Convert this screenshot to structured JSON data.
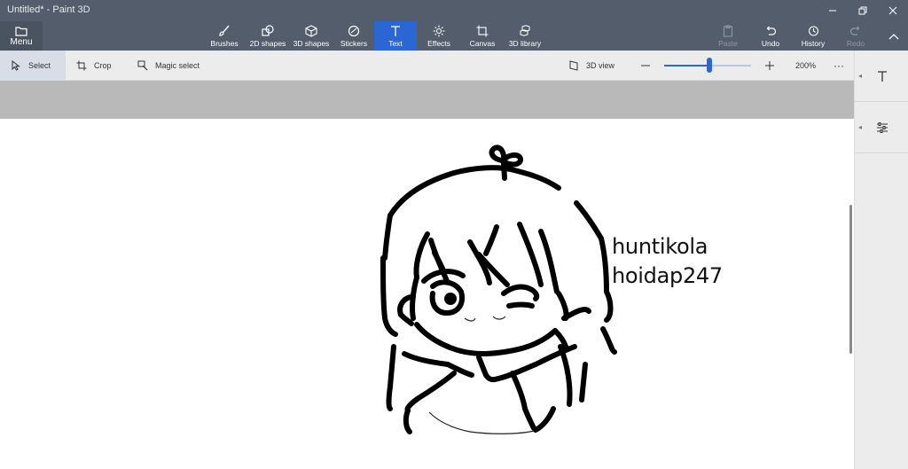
{
  "window": {
    "title": "Untitled* - Paint 3D"
  },
  "menu": {
    "label": "Menu"
  },
  "tools": [
    {
      "id": "brushes",
      "label": "Brushes",
      "icon": "brush-icon"
    },
    {
      "id": "2d-shapes",
      "label": "2D shapes",
      "icon": "2d-shapes-icon"
    },
    {
      "id": "3d-shapes",
      "label": "3D shapes",
      "icon": "cube-icon"
    },
    {
      "id": "stickers",
      "label": "Stickers",
      "icon": "sticker-icon"
    },
    {
      "id": "text",
      "label": "Text",
      "icon": "text-icon",
      "active": true
    },
    {
      "id": "effects",
      "label": "Effects",
      "icon": "sun-icon"
    },
    {
      "id": "canvas",
      "label": "Canvas",
      "icon": "canvas-icon"
    },
    {
      "id": "3d-library",
      "label": "3D library",
      "icon": "library-icon"
    }
  ],
  "actions": {
    "paste": "Paste",
    "undo": "Undo",
    "history": "History",
    "redo": "Redo"
  },
  "subbar": {
    "select": "Select",
    "crop": "Crop",
    "magic_select": "Magic select",
    "view_3d": "3D view",
    "zoom": "200%",
    "zoom_fraction": 0.52
  },
  "canvas": {
    "text_line1": "huntikola",
    "text_line2": "hoidap247"
  },
  "colors": {
    "titlebar": "#545d6b",
    "accent": "#2a66d4",
    "toolbar": "#ececec",
    "canvas_bg": "#ffffff"
  }
}
